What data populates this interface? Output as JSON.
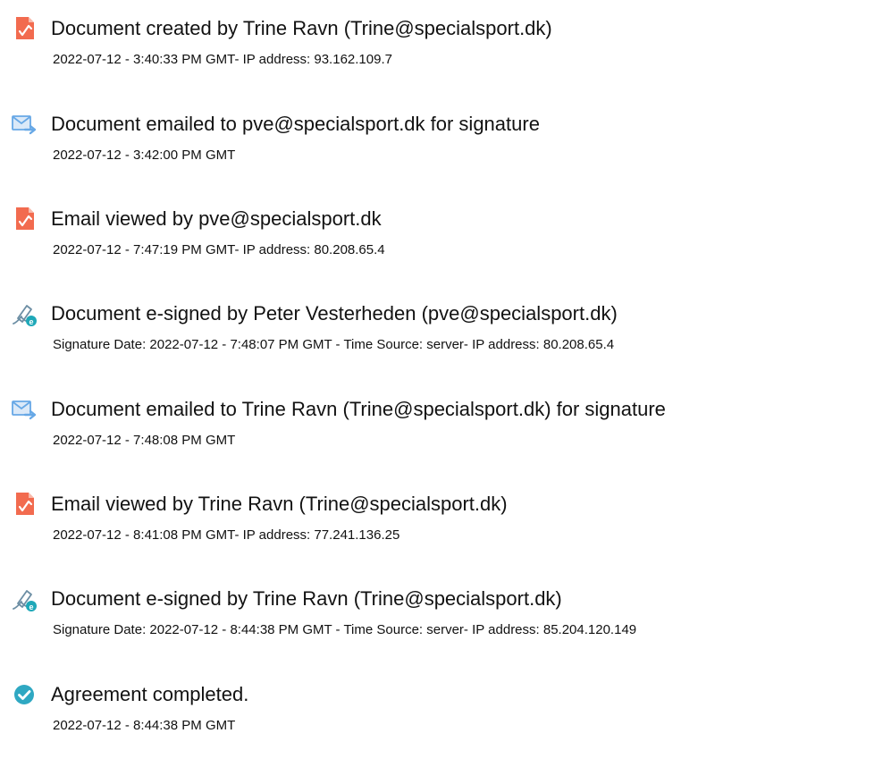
{
  "events": [
    {
      "icon": "pdf-document-icon",
      "title": "Document created by Trine Ravn (Trine@specialsport.dk)",
      "detail": "2022-07-12 - 3:40:33 PM GMT- IP address: 93.162.109.7"
    },
    {
      "icon": "email-sent-icon",
      "title": "Document emailed to pve@specialsport.dk for signature",
      "detail": "2022-07-12 - 3:42:00 PM GMT"
    },
    {
      "icon": "pdf-document-icon",
      "title": "Email viewed by pve@specialsport.dk",
      "detail": "2022-07-12 - 7:47:19 PM GMT- IP address: 80.208.65.4"
    },
    {
      "icon": "pen-signature-icon",
      "title": "Document e-signed by Peter Vesterheden (pve@specialsport.dk)",
      "detail": "Signature Date: 2022-07-12 - 7:48:07 PM GMT - Time Source: server- IP address: 80.208.65.4"
    },
    {
      "icon": "email-sent-icon",
      "title": "Document emailed to Trine Ravn (Trine@specialsport.dk) for signature",
      "detail": "2022-07-12 - 7:48:08 PM GMT"
    },
    {
      "icon": "pdf-document-icon",
      "title": "Email viewed by Trine Ravn (Trine@specialsport.dk)",
      "detail": "2022-07-12 - 8:41:08 PM GMT- IP address: 77.241.136.25"
    },
    {
      "icon": "pen-signature-icon",
      "title": "Document e-signed by Trine Ravn (Trine@specialsport.dk)",
      "detail": "Signature Date: 2022-07-12 - 8:44:38 PM GMT - Time Source: server- IP address: 85.204.120.149"
    },
    {
      "icon": "check-circle-icon",
      "title": "Agreement completed.",
      "detail": "2022-07-12 - 8:44:38 PM GMT"
    }
  ],
  "colors": {
    "pdf_icon": "#f26b4f",
    "email_icon": "#67a8e6",
    "sign_icon": "#6c8ea4",
    "sign_badge": "#1fa8b8",
    "check_icon": "#2fa8c2",
    "text": "#111111"
  }
}
